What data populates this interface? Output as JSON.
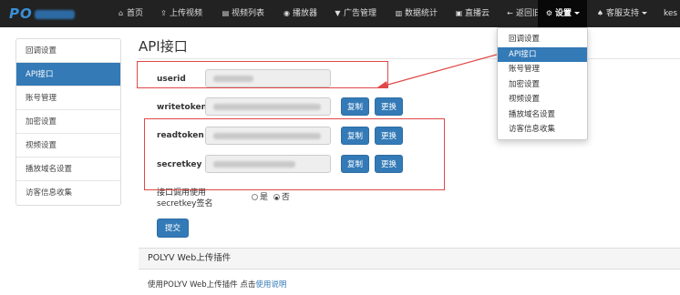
{
  "logo": {
    "text": "PO"
  },
  "nav": {
    "items": [
      {
        "icon": "home-icon",
        "glyph": "⌂",
        "label": "首页"
      },
      {
        "icon": "upload-icon",
        "glyph": "⇪",
        "label": "上传视频"
      },
      {
        "icon": "film-icon",
        "glyph": "▤",
        "label": "视频列表"
      },
      {
        "icon": "play-circle-icon",
        "glyph": "◉",
        "label": "播放器"
      },
      {
        "icon": "filter-icon",
        "glyph": "▼",
        "label": "广告管理"
      },
      {
        "icon": "bar-chart-icon",
        "glyph": "▥",
        "label": "数据统计"
      },
      {
        "icon": "live-icon",
        "glyph": "▣",
        "label": "直播云"
      },
      {
        "icon": "arrow-left-icon",
        "glyph": "←",
        "label": "返回旧版"
      }
    ],
    "settings": {
      "icon": "gear-icon",
      "glyph": "⚙",
      "label": "设置"
    },
    "support": {
      "icon": "bell-icon",
      "glyph": "♠",
      "label": "客服支持"
    },
    "user": {
      "label": "kes"
    }
  },
  "sidebar": {
    "items": [
      {
        "label": "回调设置"
      },
      {
        "label": "API接口"
      },
      {
        "label": "账号管理"
      },
      {
        "label": "加密设置"
      },
      {
        "label": "视频设置"
      },
      {
        "label": "播放域名设置"
      },
      {
        "label": "访客信息收集"
      }
    ]
  },
  "main": {
    "title": "API接口",
    "fields": {
      "userid": {
        "label": "userid"
      },
      "writetoken": {
        "label": "writetoken"
      },
      "readtoken": {
        "label": "readtoken"
      },
      "secretkey": {
        "label": "secretkey"
      }
    },
    "copy_label": "复制",
    "replace_label": "更换",
    "sign": {
      "label_line1": "接口调用使用",
      "label_line2": "secretkey签名",
      "yes": "是",
      "no": "否",
      "selected": "否"
    },
    "submit_label": "提交"
  },
  "plugin": {
    "heading": "POLYV Web上传插件",
    "text": "使用POLYV Web上传插件 点击",
    "link": "使用说明"
  },
  "dropdown": {
    "items": [
      {
        "label": "回调设置"
      },
      {
        "label": "API接口"
      },
      {
        "label": "账号管理"
      },
      {
        "label": "加密设置"
      },
      {
        "label": "视频设置"
      },
      {
        "label": "播放域名设置"
      },
      {
        "label": "访客信息收集"
      }
    ],
    "active_index": 1
  },
  "colors": {
    "nav_bg": "#222222",
    "primary": "#337ab7",
    "highlight_box": "#e04848"
  }
}
